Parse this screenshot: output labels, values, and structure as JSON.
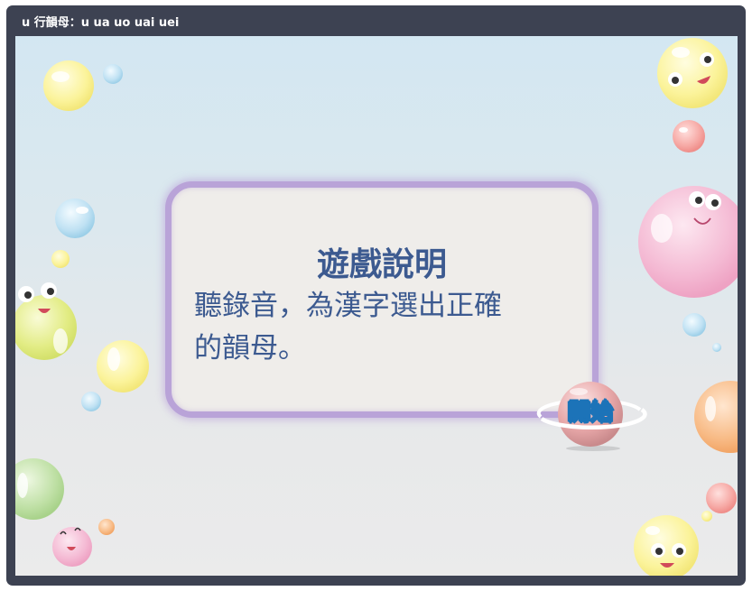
{
  "window": {
    "title": "u 行韻母：u ua uo uai uei"
  },
  "panel": {
    "title": "遊戲說明",
    "body_line1": "聽錄音，為漢字選出正確",
    "body_line2": "的韻母。"
  },
  "start_button": {
    "label": "開始"
  },
  "colors": {
    "frame": "#3d4252",
    "panel_border": "#b9a3d8",
    "panel_bg": "#efedea",
    "text": "#3c5a90",
    "button_text_outline": "#1c73b8"
  }
}
